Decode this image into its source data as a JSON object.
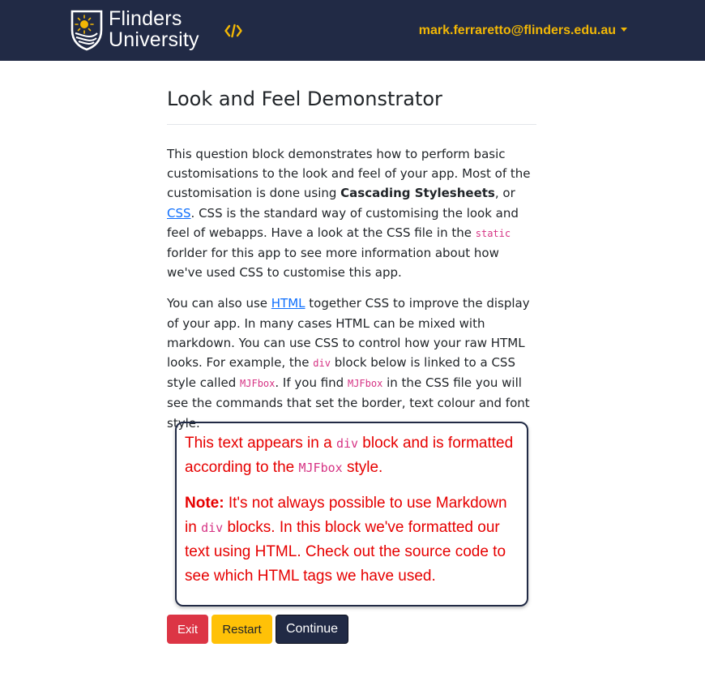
{
  "header": {
    "logo_line1": "Flinders",
    "logo_line2": "University",
    "code_icon": "code-brackets-icon",
    "user_email": "mark.ferraretto@flinders.edu.au",
    "colors": {
      "background": "#212a45",
      "accent": "#f2b705"
    }
  },
  "page": {
    "title": "Look and Feel Demonstrator",
    "para1": {
      "t1": "This question block demonstrates how to perform basic customisations to the look and feel of your app. Most of the customisation is done using ",
      "bold": "Cascading Stylesheets",
      "t2": ", or ",
      "link": "CSS",
      "t3": ". CSS is the standard way of customising the look and feel of webapps. Have a look at the CSS file in the ",
      "code": "static",
      "t4": " forlder for this app to see more information about how we've used CSS to customise this app."
    },
    "para2": {
      "t1": "You can also use ",
      "link": "HTML",
      "t2": " together CSS to improve the display of your app. In many cases HTML can be mixed with markdown. You can use CSS to control how your raw HTML looks. For example, the ",
      "code1": "div",
      "t3": " block below is linked to a CSS style called ",
      "code2": "MJFbox",
      "t4": ". If you find ",
      "code3": "MJFbox",
      "t5": " in the CSS file you will see the commands that set the border, text colour and font style."
    }
  },
  "mjfbox": {
    "p1": {
      "t1": "This text appears in a ",
      "code1": "div",
      "t2": " block and is formatted according to the ",
      "code2": "MJFbox",
      "t3": " style."
    },
    "p2": {
      "bold": "Note:",
      "t1": " It's not always possible to use Markdown in ",
      "code": "div",
      "t2": " blocks. In this block we've formatted our text using HTML. Check out the source code to see which HTML tags we have used."
    },
    "colors": {
      "text": "#e60000",
      "border": "#212a45"
    }
  },
  "buttons": {
    "exit": "Exit",
    "restart": "Restart",
    "continue": "Continue"
  }
}
